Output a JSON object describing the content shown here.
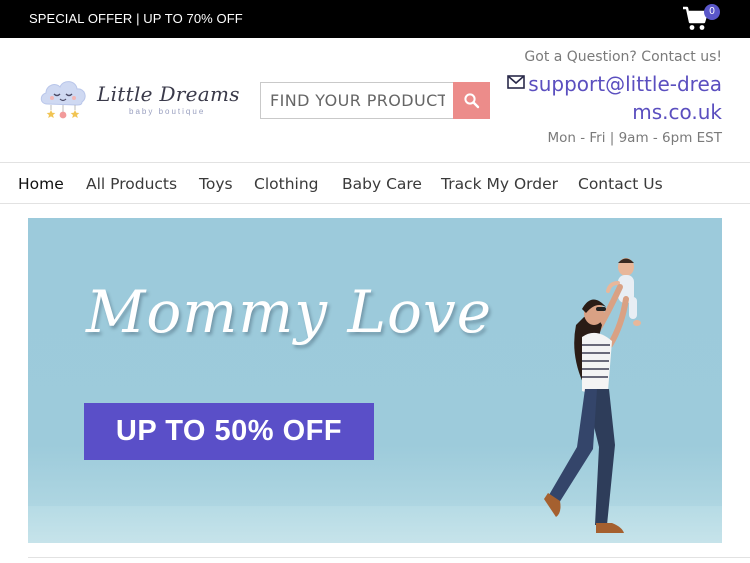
{
  "topbar": {
    "offer_text": "SPECIAL OFFER | UP TO 70% OFF",
    "cart_count": "0",
    "cart_icon": "shopping-cart-icon"
  },
  "logo": {
    "name": "Little Dreams",
    "tagline": "baby boutique"
  },
  "search": {
    "placeholder": "FIND YOUR PRODUCT",
    "button_icon": "search-icon"
  },
  "contact": {
    "question": "Got a Question? Contact us!",
    "email": "support@little-dreams.co.uk",
    "hours": "Mon - Fri | 9am - 6pm EST"
  },
  "nav": {
    "items": [
      "Home",
      "All Products",
      "Toys",
      "Clothing",
      "Baby Care",
      "Track My Order",
      "Contact Us"
    ],
    "active": "Home"
  },
  "hero": {
    "headline": "Mommy Love",
    "cta": "UP TO 50% OFF"
  },
  "colors": {
    "topbar_bg": "#000000",
    "accent_purple": "#5a4fc8",
    "search_button": "#ec8c8a",
    "hero_sky": "#9dcbdb"
  }
}
